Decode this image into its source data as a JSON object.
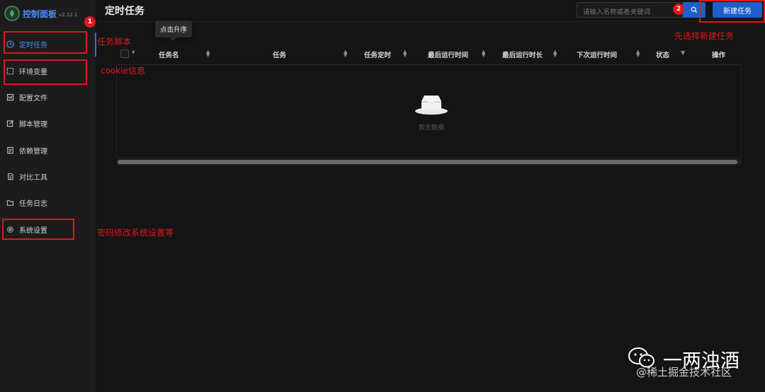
{
  "app": {
    "title": "控制面板",
    "version": "v2.12.1"
  },
  "sidebar": {
    "items": [
      {
        "label": "定时任务",
        "icon": "clock-icon",
        "active": true
      },
      {
        "label": "环境变量",
        "icon": "env-icon"
      },
      {
        "label": "配置文件",
        "icon": "config-icon"
      },
      {
        "label": "脚本管理",
        "icon": "edit-icon"
      },
      {
        "label": "依赖管理",
        "icon": "package-icon"
      },
      {
        "label": "对比工具",
        "icon": "diff-icon"
      },
      {
        "label": "任务日志",
        "icon": "folder-icon"
      },
      {
        "label": "系统设置",
        "icon": "gear-icon"
      }
    ]
  },
  "header": {
    "title": "定时任务",
    "search_placeholder": "请输入名称或者关键词",
    "new_task_label": "新建任务"
  },
  "tooltip": "点击升序",
  "table": {
    "columns": [
      "任务名",
      "任务",
      "任务定时",
      "最后运行时间",
      "最后运行时长",
      "下次运行时间",
      "状态",
      "操作"
    ],
    "empty_text": "暂无数据"
  },
  "annotations": {
    "task_script": "任务脚本",
    "cookie_info": "cookie信息",
    "system_settings": "密码修改系统设置等",
    "new_task_hint": "先选择新建任务",
    "badge1": "1",
    "badge2": "2"
  },
  "watermark": {
    "name": "一两浊酒",
    "site": "@稀土掘金技术社区"
  },
  "colors": {
    "accent": "#1d5ec9",
    "annotation": "#e0161b",
    "background": "#141414"
  }
}
